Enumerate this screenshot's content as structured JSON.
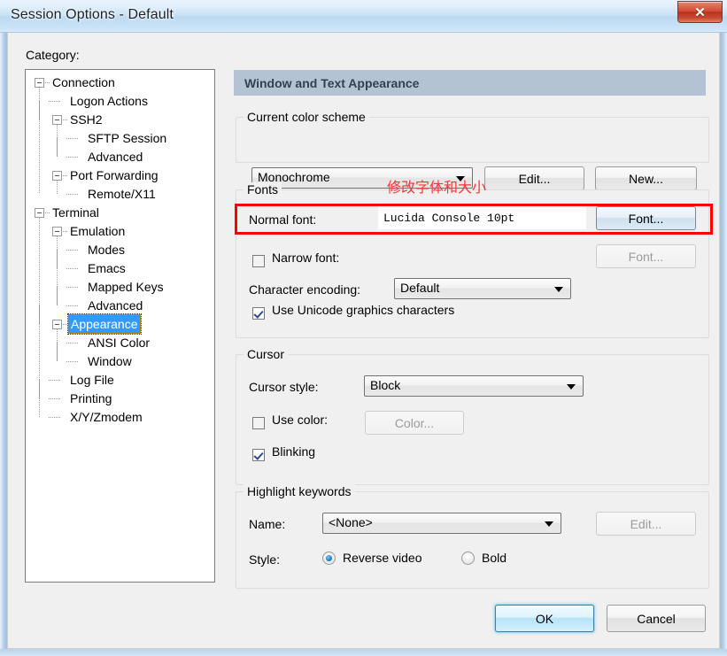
{
  "window": {
    "title": "Session Options - Default",
    "close_label": "✕",
    "close_icon": "close-icon"
  },
  "left": {
    "category_label": "Category:",
    "tree": [
      {
        "label": "Connection",
        "depth": 0,
        "expander": "minus",
        "selected": false
      },
      {
        "label": "Logon Actions",
        "depth": 1,
        "expander": "none",
        "selected": false
      },
      {
        "label": "SSH2",
        "depth": 1,
        "expander": "minus",
        "selected": false
      },
      {
        "label": "SFTP Session",
        "depth": 2,
        "expander": "none",
        "selected": false
      },
      {
        "label": "Advanced",
        "depth": 2,
        "expander": "none",
        "selected": false
      },
      {
        "label": "Port Forwarding",
        "depth": 1,
        "expander": "minus",
        "selected": false
      },
      {
        "label": "Remote/X11",
        "depth": 2,
        "expander": "none",
        "selected": false
      },
      {
        "label": "Terminal",
        "depth": 0,
        "expander": "minus",
        "selected": false
      },
      {
        "label": "Emulation",
        "depth": 1,
        "expander": "minus",
        "selected": false
      },
      {
        "label": "Modes",
        "depth": 2,
        "expander": "none",
        "selected": false
      },
      {
        "label": "Emacs",
        "depth": 2,
        "expander": "none",
        "selected": false
      },
      {
        "label": "Mapped Keys",
        "depth": 2,
        "expander": "none",
        "selected": false
      },
      {
        "label": "Advanced",
        "depth": 2,
        "expander": "none",
        "selected": false
      },
      {
        "label": "Appearance",
        "depth": 1,
        "expander": "minus",
        "selected": true
      },
      {
        "label": "ANSI Color",
        "depth": 2,
        "expander": "none",
        "selected": false
      },
      {
        "label": "Window",
        "depth": 2,
        "expander": "none",
        "selected": false
      },
      {
        "label": "Log File",
        "depth": 1,
        "expander": "none",
        "selected": false
      },
      {
        "label": "Printing",
        "depth": 1,
        "expander": "none",
        "selected": false
      },
      {
        "label": "X/Y/Zmodem",
        "depth": 1,
        "expander": "none",
        "selected": false
      }
    ]
  },
  "pane": {
    "header": "Window and Text Appearance",
    "color_scheme": {
      "group_title": "Current color scheme",
      "value": "Monochrome",
      "edit_label": "Edit...",
      "new_label": "New..."
    },
    "fonts": {
      "group_title": "Fonts",
      "normal_font_label": "Normal font:",
      "normal_font_value": "Lucida Console 10pt",
      "normal_font_button": "Font...",
      "narrow_font_label": "Narrow font:",
      "narrow_font_button": "Font...",
      "narrow_font_checked": false,
      "encoding_label": "Character encoding:",
      "encoding_value": "Default",
      "unicode_label": "Use Unicode graphics characters",
      "unicode_checked": true
    },
    "cursor": {
      "group_title": "Cursor",
      "style_label": "Cursor style:",
      "style_value": "Block",
      "use_color_label": "Use color:",
      "use_color_checked": false,
      "color_button": "Color...",
      "blinking_label": "Blinking",
      "blinking_checked": true
    },
    "highlight": {
      "group_title": "Highlight keywords",
      "name_label": "Name:",
      "name_value": "<None>",
      "edit_label": "Edit...",
      "style_label": "Style:",
      "reverse_video_label": "Reverse video",
      "bold_label": "Bold",
      "selected_style": "Reverse video"
    }
  },
  "annotation": {
    "text": "修改字体和大小",
    "color": "#ff0000"
  },
  "footer": {
    "ok_label": "OK",
    "cancel_label": "Cancel"
  }
}
